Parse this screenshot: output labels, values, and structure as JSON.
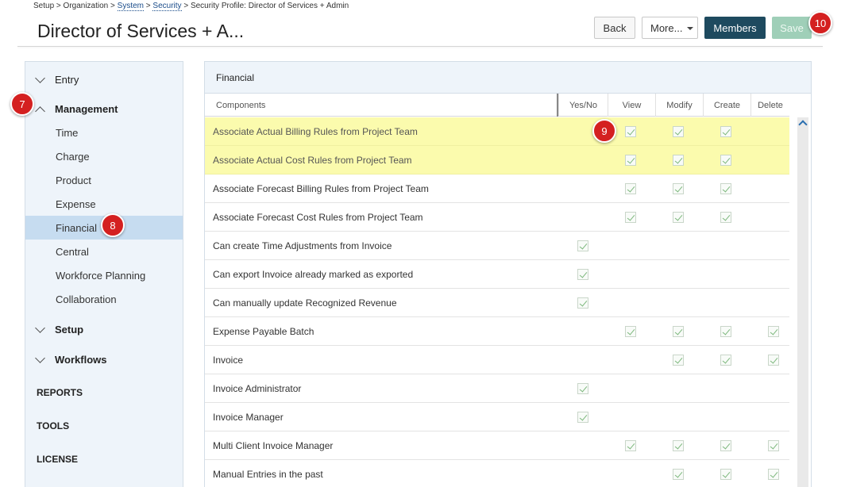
{
  "breadcrumb": {
    "setup": "Setup",
    "sep1": ">",
    "organization": "Organization",
    "sep2": ">",
    "system": "System",
    "sep3": ">",
    "security": "Security",
    "sep4": ">",
    "current": "Security Profile: Director of Services + Admin"
  },
  "page_title": "Director of Services + A...",
  "toolbar": {
    "back_label": "Back",
    "more_label": "More...",
    "members_label": "Members",
    "save_label": "Save"
  },
  "badges": {
    "b7": "7",
    "b8": "8",
    "b9": "9",
    "b10": "10"
  },
  "sidebar": {
    "entry": "Entry",
    "management": "Management",
    "management_items": [
      "Time",
      "Charge",
      "Product",
      "Expense",
      "Financial",
      "Central",
      "Workforce Planning",
      "Collaboration"
    ],
    "setup": "Setup",
    "workflows": "Workflows",
    "reports": "REPORTS",
    "tools": "TOOLS",
    "license": "LICENSE"
  },
  "panel": {
    "title": "Financial",
    "columns": {
      "components": "Components",
      "yesno": "Yes/No",
      "view": "View",
      "modify": "Modify",
      "create": "Create",
      "delete": "Delete"
    },
    "rows": [
      {
        "name": "Associate Actual Billing Rules from Project Team",
        "highlight": true,
        "yesno": false,
        "view": true,
        "modify": true,
        "create": true,
        "delete": false
      },
      {
        "name": "Associate Actual Cost Rules from Project Team",
        "highlight": true,
        "yesno": false,
        "view": true,
        "modify": true,
        "create": true,
        "delete": false
      },
      {
        "name": "Associate Forecast Billing Rules from Project Team",
        "highlight": false,
        "yesno": false,
        "view": true,
        "modify": true,
        "create": true,
        "delete": false
      },
      {
        "name": "Associate Forecast Cost Rules from Project Team",
        "highlight": false,
        "yesno": false,
        "view": true,
        "modify": true,
        "create": true,
        "delete": false
      },
      {
        "name": "Can create Time Adjustments from Invoice",
        "highlight": false,
        "yesno": true,
        "view": false,
        "modify": false,
        "create": false,
        "delete": false
      },
      {
        "name": "Can export Invoice already marked as exported",
        "highlight": false,
        "yesno": true,
        "view": false,
        "modify": false,
        "create": false,
        "delete": false
      },
      {
        "name": "Can manually update Recognized Revenue",
        "highlight": false,
        "yesno": true,
        "view": false,
        "modify": false,
        "create": false,
        "delete": false
      },
      {
        "name": "Expense Payable Batch",
        "highlight": false,
        "yesno": false,
        "view": true,
        "modify": true,
        "create": true,
        "delete": true
      },
      {
        "name": "Invoice",
        "highlight": false,
        "yesno": false,
        "view": false,
        "modify": true,
        "create": true,
        "delete": true
      },
      {
        "name": "Invoice Administrator",
        "highlight": false,
        "yesno": true,
        "view": false,
        "modify": false,
        "create": false,
        "delete": false
      },
      {
        "name": "Invoice Manager",
        "highlight": false,
        "yesno": true,
        "view": false,
        "modify": false,
        "create": false,
        "delete": false
      },
      {
        "name": "Multi Client Invoice Manager",
        "highlight": false,
        "yesno": false,
        "view": true,
        "modify": true,
        "create": true,
        "delete": true
      },
      {
        "name": "Manual Entries in the past",
        "highlight": false,
        "yesno": false,
        "view": false,
        "modify": true,
        "create": true,
        "delete": true
      }
    ]
  },
  "icons": {
    "expand": "chevron-down-icon",
    "collapse": "chevron-up-icon",
    "check": "check-icon",
    "scroll_up": "chevron-up-icon",
    "dropdown": "caret-down-icon"
  },
  "colors": {
    "members_bg": "#1e4a5f",
    "save_bg": "#9fcfb8",
    "badge": "#d42020",
    "highlight": "#fbfbad",
    "active_item": "#c6dcf0"
  }
}
